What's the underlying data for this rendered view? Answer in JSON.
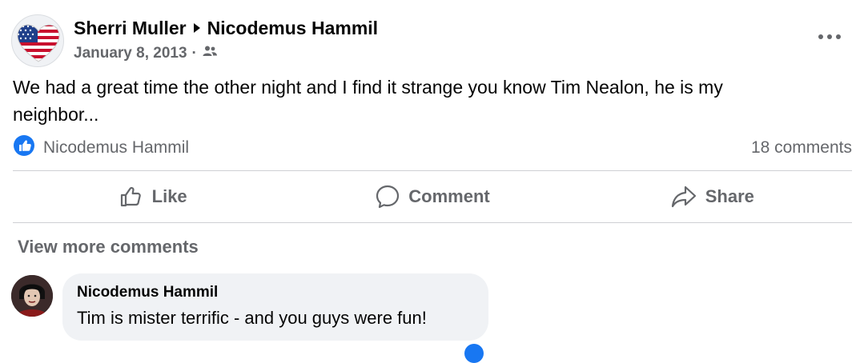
{
  "post": {
    "author": "Sherri Muller",
    "target": "Nicodemus Hammil",
    "date": "January 8, 2013",
    "separator": "·",
    "privacy_icon": "friends-icon",
    "text_line1": "We had a great time the other night and I find it strange you know Tim Nealon, he is my",
    "text_line2": "neighbor...",
    "more_icon": "more-options-icon"
  },
  "reactions": {
    "liked_by": "Nicodemus Hammil",
    "comments": "18 comments",
    "like_color": "#1877f2"
  },
  "actions": {
    "like": "Like",
    "comment": "Comment",
    "share": "Share"
  },
  "comments_section": {
    "view_more": "View more comments",
    "items": [
      {
        "name": "Nicodemus Hammil",
        "text": "Tim is mister terrific - and you guys were fun!"
      }
    ]
  },
  "colors": {
    "secondary_text": "#65676b",
    "bubble_bg": "#f0f2f5",
    "divider": "#ced0d4"
  }
}
